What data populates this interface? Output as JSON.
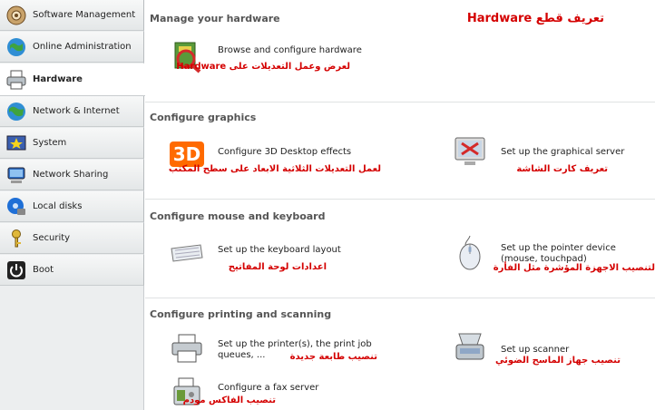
{
  "sidebar": {
    "items": [
      {
        "label": "Software Management",
        "icon": "software-management-icon"
      },
      {
        "label": "Online Administration",
        "icon": "online-administration-icon"
      },
      {
        "label": "Hardware",
        "icon": "hardware-printer-icon",
        "active": true
      },
      {
        "label": "Network & Internet",
        "icon": "globe-icon"
      },
      {
        "label": "System",
        "icon": "system-star-icon"
      },
      {
        "label": "Network Sharing",
        "icon": "network-sharing-icon"
      },
      {
        "label": "Local disks",
        "icon": "local-disks-icon"
      },
      {
        "label": "Security",
        "icon": "security-key-icon"
      },
      {
        "label": "Boot",
        "icon": "boot-power-icon"
      }
    ]
  },
  "main": {
    "header_title": "Manage your hardware",
    "header_annotation": "تعريف قطع Hardware",
    "browse": {
      "label": "Browse and configure hardware",
      "annotation": "لعرض وعمل التعديلات على Hardware"
    },
    "graphics": {
      "title": "Configure graphics",
      "desktop3d": {
        "badge": "3D",
        "label": "Configure 3D Desktop effects",
        "annotation": "لعمل التعديلات الثلاثية الابعاد على سطح المكتب"
      },
      "graphical_server": {
        "label": "Set up the graphical server",
        "annotation": "تعريف كارت الشاشة"
      }
    },
    "input": {
      "title": "Configure mouse and keyboard",
      "keyboard": {
        "label": "Set up the keyboard layout",
        "annotation": "اعدادات لوحة المفاتيح"
      },
      "pointer": {
        "label": "Set up the pointer device (mouse, touchpad)",
        "annotation": "لتنصيب الاجهزة المؤشرة مثل الفأرة"
      }
    },
    "printing": {
      "title": "Configure printing and scanning",
      "printer": {
        "label_line1": "Set up the printer(s), the print job",
        "label_line2": "queues, ...",
        "annotation": "تنصيب طابعة جديدة"
      },
      "scanner": {
        "label": "Set up scanner",
        "annotation": "تنصيب جهاز الماسح الضوئي"
      },
      "fax": {
        "label": "Configure a fax server",
        "annotation": "تنصيب الفاكس مودم"
      }
    }
  },
  "colors": {
    "annotation": "#d40000",
    "section_title": "#555555",
    "sidebar_bg": "#eceeef"
  }
}
